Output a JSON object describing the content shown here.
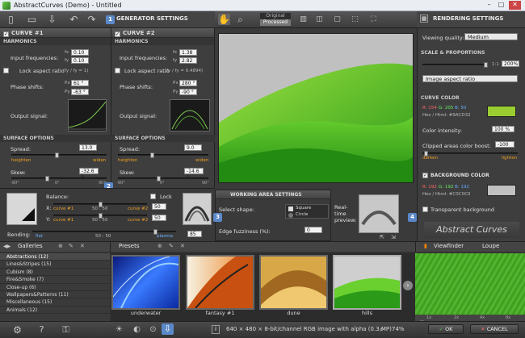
{
  "window": {
    "title": "AbstractCurves (Demo) - Untitled"
  },
  "toolbar": {
    "tabs": [
      "Original",
      "Processed"
    ],
    "rendering_title": "RENDERING SETTINGS",
    "generator_title": "GENERATOR SETTINGS"
  },
  "curve1": {
    "title": "CURVE #1",
    "harmonics": "HARMONICS",
    "input_freq_label": "Input frequencies:",
    "fx": "0.10",
    "fy": "0.10",
    "lock_ratio": "Lock aspect ratio",
    "lock_ratio_hint": "(fy / fy = 1)",
    "phase_label": "Phase shifts:",
    "px": "61 °",
    "py": "-63 °",
    "output_label": "Output signal:",
    "surface": "SURFACE OPTIONS",
    "spread_label": "Spread:",
    "spread": "13.0",
    "spread_lo": "heighten",
    "spread_hi": "widen",
    "skew_label": "Skew:",
    "skew": "-32.6 °",
    "skew_ticks": [
      "-90°",
      "0°",
      "90°"
    ]
  },
  "curve2": {
    "title": "CURVE #2",
    "harmonics": "HARMONICS",
    "input_freq_label": "Input frequencies:",
    "fx": "1.38",
    "fy": "2.82",
    "lock_ratio": "Lock aspect ratio",
    "lock_ratio_hint": "(fy / fy = 0.4894)",
    "phase_label": "Phase shifts:",
    "px": "280 °",
    "py": "-90 °",
    "output_label": "Output signal:",
    "surface": "SURFACE OPTIONS",
    "spread_label": "Spread:",
    "spread": "9.0",
    "spread_lo": "heighten",
    "spread_hi": "widen",
    "skew_label": "Skew:",
    "skew": "-14.6 °",
    "skew_ticks": [
      "-90°",
      "0°",
      "90°"
    ]
  },
  "balance": {
    "label": "Balance:",
    "lock": "Lock",
    "x_label": "X:",
    "y_label": "Y:",
    "x_left": "curve #1",
    "x_mid": "50 : 50",
    "x_right": "curve #2",
    "y_left": "curve #1",
    "y_mid": "50 : 50",
    "y_right": "curve #2",
    "x_val": "50",
    "y_val": "50",
    "bending_label": "Bending:",
    "bend_left": "flat",
    "bend_mid": "50 : 50",
    "bend_right": "plasma",
    "bend_val": "85"
  },
  "working": {
    "title": "WORKING AREA SETTINGS",
    "shape_label": "Select shape:",
    "square": "Square",
    "circle": "Circle",
    "fuzz_label": "Edge fuzziness (%):",
    "fuzz": "0",
    "preview_label": "Real-time preview:"
  },
  "rendering": {
    "quality_label": "Viewing quality:",
    "quality": "Medium",
    "scale_title": "SCALE & PROPORTIONS",
    "ratio_val": "1:1",
    "zoom": "200%",
    "aspect": "Image aspect ratio",
    "curve_color": "CURVE COLOR",
    "r": "R: 154",
    "g": "G: 205",
    "b": "B: 50",
    "hex": "Hex / Html: #9ACD32",
    "curve_hex": "#9ACD32",
    "intensity_label": "Color intensity:",
    "intensity": "100 %",
    "clipped_label": "Clipped areas color boost:",
    "clipped": "-100",
    "darken": "darken",
    "lighten": "lighten",
    "bg_color": "BACKGROUND COLOR",
    "bg_r": "R: 192",
    "bg_g": "G: 192",
    "bg_b": "B: 192",
    "bg_hex": "Hex / Html: #C0C0C0",
    "bg_hex_val": "#C0C0C0",
    "transparent": "Transparent background",
    "logo": "Abstract Curves"
  },
  "bottom": {
    "galleries": "Galleries",
    "presets": "Presets",
    "viewfinder": "Viewfinder",
    "loupe": "Loupe",
    "zoom_ticks": [
      "1x",
      "2x",
      "4x",
      "8x"
    ],
    "categories": [
      "Abstractions (12)",
      "Lines&Stripes (15)",
      "Cubism (8)",
      "Fire&Smoke (7)",
      "Close-up (6)",
      "Wallpapers&Patterns (11)",
      "Miscellaneous (15)",
      "Animals (12)"
    ],
    "thumbs": [
      "underwater",
      "fantasy #1",
      "dune",
      "hills"
    ],
    "status": "640 × 480 × 8-bit/channel RGB image with alpha  (0.3 MP)",
    "zoom": "74%",
    "ok": "OK",
    "cancel": "CANCEL"
  },
  "badges": [
    "1",
    "2",
    "3",
    "4"
  ]
}
